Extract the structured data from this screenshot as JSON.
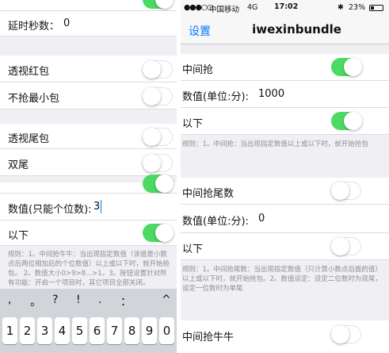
{
  "left": {
    "rows": {
      "partial_top": "",
      "delay_label": "延时秒数：",
      "delay_value": "0",
      "perspective_red_label": "透视红包",
      "skip_smallest_label": "不抢最小包",
      "perspective_tail_label": "透视尾包",
      "double_tail_label": "双尾",
      "partial_mid": "",
      "value_label": "数值(只能个位数):",
      "value_input": "3",
      "below_label": "以下",
      "note": "规则：1。中间抢牛牛：当出现指定数值（该值是小数点后两位相加后的个位数值）以上或以下时，就开始抢包。 2。数值大小0>9>8...>1。3。按钮设置针对所有功能：开启一个项目时，其它项目全部关闭。"
    },
    "keyboard": {
      "punct": [
        ",",
        "。",
        "?",
        "!",
        ".",
        "：",
        "^"
      ],
      "digits": [
        "1",
        "2",
        "3",
        "4",
        "5",
        "6",
        "7",
        "8",
        "9",
        "0"
      ]
    }
  },
  "right": {
    "status": {
      "carrier": "中国移动",
      "network": "4G",
      "time": "17:02",
      "battery": "23%"
    },
    "nav": {
      "back": "设置",
      "title": "iwexinbundle"
    },
    "rows": {
      "middle_grab": "中间抢",
      "value_label": "数值(单位:分):",
      "value_input": "1000",
      "below1": "以下",
      "note1": "规则：1。中间抢：当出现指定数值以上或以下时，就开始抢包",
      "middle_tail": "中间抢尾数",
      "value2_label": "数值(单位:分):",
      "value2_input": "0",
      "below2": "以下",
      "note2": "规则：1。中间抢尾数：当出现指定数值（只计算小数点后面的值）以上或以下时，就开始抢包。2。数值设定：设定二位数时为双尾，设定一位数时为单尾",
      "middle_niuniu": "中间抢牛牛"
    }
  }
}
